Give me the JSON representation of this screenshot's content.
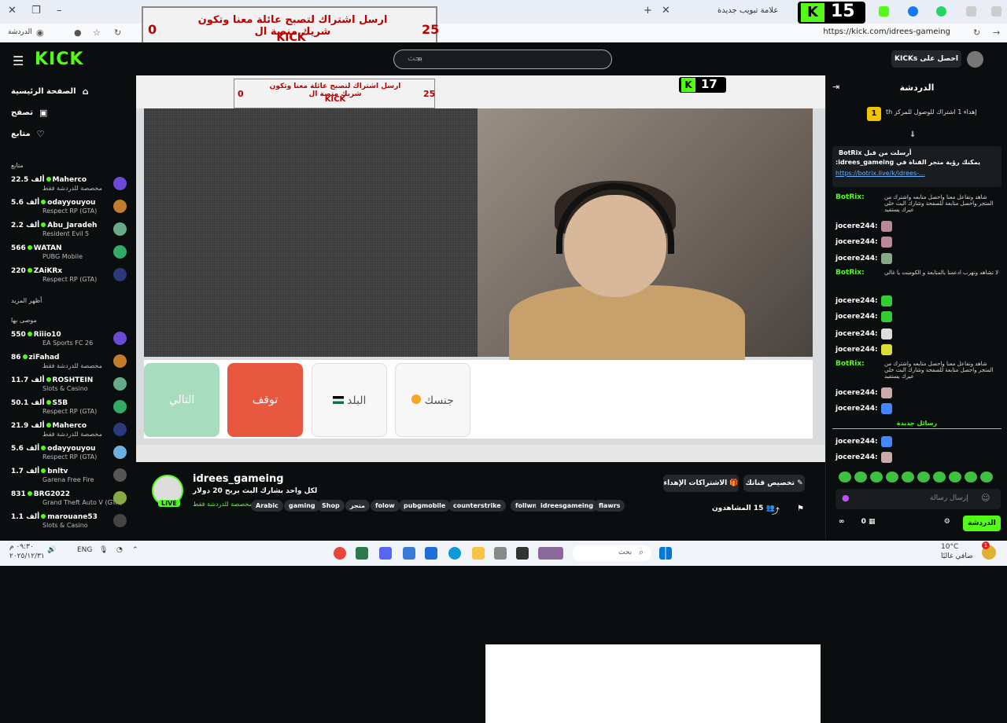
{
  "browser": {
    "tab_title": "علامة تبويب جديدة",
    "url": "https://kick.com/idrees-gameing",
    "chat_label": "الدردشة",
    "kick_counter": "15"
  },
  "banner": {
    "line1": "ارسل اشتراك لتصبح عائلة معنا وتكون شريك منصة ال",
    "line2": "KICK",
    "left_num": "0",
    "right_num": "25"
  },
  "header": {
    "logo": "KICK",
    "search_placeholder": "بحث",
    "get_kicks": "احصل على KICKs"
  },
  "sidebar": {
    "nav": [
      {
        "label": "الصفحة الرئيسية",
        "icon": "home-icon",
        "glyph": "⌂"
      },
      {
        "label": "تصفح",
        "icon": "browse-icon",
        "glyph": "▣"
      },
      {
        "label": "متابع",
        "icon": "heart-icon",
        "glyph": "♡"
      }
    ],
    "following_title": "متابع",
    "show_more": "أظهر المزيد",
    "recommended_title": "موصى بها",
    "following": [
      {
        "name": "Maherco",
        "viewers": "22.5 ألف",
        "category": "مخصصة للدردشة فقط"
      },
      {
        "name": "odayyouyou",
        "viewers": "5.6 ألف",
        "category": "Respect RP (GTA)"
      },
      {
        "name": "Abu_Jaradeh",
        "viewers": "2.2 ألف",
        "category": "Resident Evil 5"
      },
      {
        "name": "WATAN",
        "viewers": "566",
        "category": "PUBG Mobile"
      },
      {
        "name": "ZAiKRx",
        "viewers": "220",
        "category": "Respect RP (GTA)"
      }
    ],
    "recommended": [
      {
        "name": "Riiio10",
        "viewers": "550",
        "category": "EA Sports FC 26"
      },
      {
        "name": "ziFahad",
        "viewers": "86",
        "category": "مخصصة للدردشة فقط"
      },
      {
        "name": "ROSHTEIN",
        "viewers": "11.7 ألف",
        "category": "Slots & Casino"
      },
      {
        "name": "S5B",
        "viewers": "50.1 ألف",
        "category": "Respect RP (GTA)"
      },
      {
        "name": "Maherco",
        "viewers": "21.9 ألف",
        "category": "مخصصة للدردشة فقط"
      },
      {
        "name": "odayyouyou",
        "viewers": "5.6 ألف",
        "category": "Respect RP (GTA)"
      },
      {
        "name": "bnltv",
        "viewers": "1.7 ألف",
        "category": "Garena Free Fire"
      },
      {
        "name": "BRG2022",
        "viewers": "831",
        "category": "Grand Theft Auto V (GTA)"
      },
      {
        "name": "marouane53",
        "viewers": "1.1 ألف",
        "category": "Slots & Casino"
      }
    ]
  },
  "stream": {
    "inner_counter": "17",
    "buttons": {
      "next": "التالي",
      "stop": "توقف",
      "country": "البلد",
      "gender": "جنسك"
    }
  },
  "info": {
    "name": "idrees_gameing",
    "title": "لكل واحد بشارك البث بربح 20 دولار",
    "category": "مخصصة للدردشة فقط",
    "live": "LIVE",
    "tags": [
      "Arabic",
      "gaming",
      "Shop",
      "متجر",
      "folow",
      "pubgmobile",
      "counterstrike",
      "follwme",
      "idreesgameing",
      "flawrs"
    ],
    "customize": "تخصيص قناتك",
    "gift_subs": "الاشتراكات الإهداء",
    "viewers_label": "المشاهدون",
    "viewers": "15"
  },
  "chat": {
    "title": "الدردشة",
    "goal_text": "إهداء 1 اشتراك للوصول للمركز th",
    "goal_rank": "1",
    "pinned_by": "BotRix  أرسلت من قبل",
    "pinned_msg": "يمكنك رؤية متجر القناة في idrees_gameing:",
    "pinned_link": "https://botrix.live/k/idrees-...",
    "bot_name": "BotRix:",
    "bot_msg1": "شاهد وتفاعل معنا واحصل متابعه واشترك من المتجر واحصل متابعة للصفحة وشارك البث خلي عيرك يستفيد",
    "bot_msg2": "لا تشاهد وتهرب ادعمنا بالمتابعة و الكومنت يا غالي",
    "user": "jocere244:",
    "new_messages": "رسائل جديدة",
    "input_placeholder": "إرسال رسالة",
    "send": "الدردشة",
    "points": "0"
  },
  "taskbar": {
    "lang": "ENG",
    "time": "٠٩:٣٠ م",
    "date": "٢٠٢٥/١٢/٣١",
    "weather": "10°C",
    "weather_text": "صافي غالبًا",
    "search": "بحث",
    "notif": "1"
  },
  "colors": {
    "kick_green": "#53fc18",
    "bg": "#0b0e0f",
    "stop_red": "#e8583f",
    "next_green": "#a8dcbf"
  }
}
